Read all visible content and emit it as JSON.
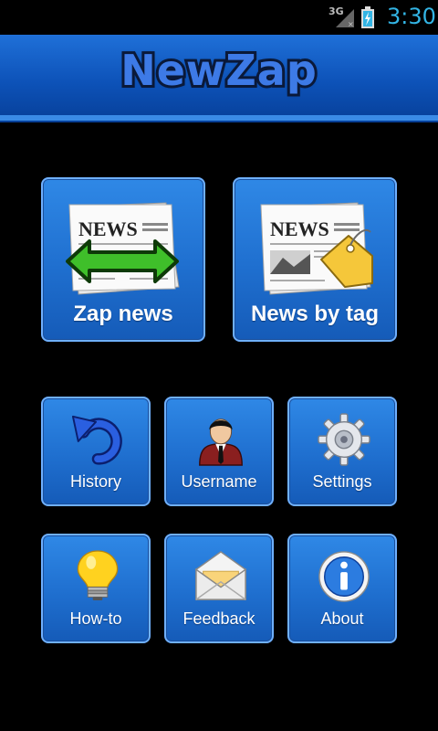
{
  "status_bar": {
    "network": "3G",
    "time": "3:30",
    "signal_icon": "signal-icon",
    "battery_icon": "battery-charging-icon"
  },
  "header": {
    "title": "NewZap"
  },
  "tiles": {
    "zap_news": {
      "label": "Zap news",
      "icon": "newspaper-arrows-icon"
    },
    "news_by_tag": {
      "label": "News by tag",
      "icon": "newspaper-tag-icon"
    },
    "history": {
      "label": "History",
      "icon": "undo-arrow-icon"
    },
    "username": {
      "label": "Username",
      "icon": "user-icon"
    },
    "settings": {
      "label": "Settings",
      "icon": "gear-icon"
    },
    "how_to": {
      "label": "How-to",
      "icon": "lightbulb-icon"
    },
    "feedback": {
      "label": "Feedback",
      "icon": "envelope-icon"
    },
    "about": {
      "label": "About",
      "icon": "info-icon"
    }
  },
  "newspaper": {
    "headline": "NEWS"
  },
  "colors": {
    "accent": "#33b5e5",
    "tile": "#1f6fcf",
    "header": "#0d52b8"
  }
}
